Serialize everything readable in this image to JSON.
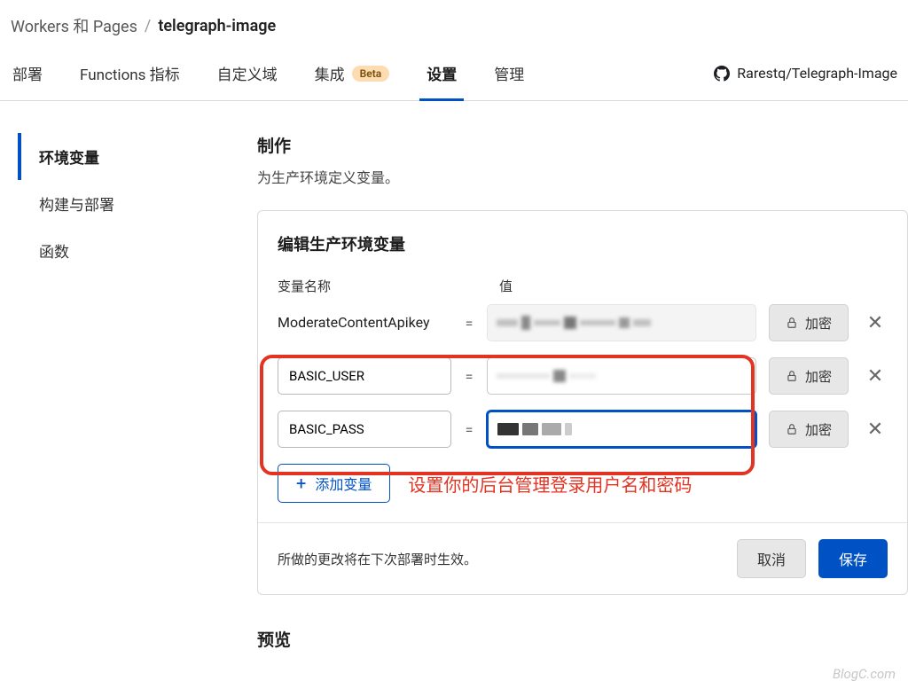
{
  "breadcrumb": {
    "parent": "Workers 和 Pages",
    "current": "telegraph-image"
  },
  "tabs": {
    "items": [
      {
        "label": "部署"
      },
      {
        "label": "Functions 指标"
      },
      {
        "label": "自定义域"
      },
      {
        "label": "集成",
        "badge": "Beta"
      },
      {
        "label": "设置",
        "active": true
      },
      {
        "label": "管理"
      }
    ],
    "repo": "Rarestq/Telegraph-Image"
  },
  "sidebar": {
    "items": [
      {
        "label": "环境变量",
        "active": true
      },
      {
        "label": "构建与部署"
      },
      {
        "label": "函数"
      }
    ]
  },
  "production": {
    "title": "制作",
    "desc": "为生产环境定义变量。"
  },
  "card": {
    "title": "编辑生产环境变量",
    "name_header": "变量名称",
    "value_header": "值",
    "vars": [
      {
        "name": "ModerateContentApikey",
        "value": ""
      },
      {
        "name": "BASIC_USER",
        "value": ""
      },
      {
        "name": "BASIC_PASS",
        "value": ""
      }
    ],
    "encrypt_label": "加密",
    "add_label": "添加变量",
    "annotation": "设置你的后台管理登录用户名和密码",
    "footer_note": "所做的更改将在下次部署时生效。",
    "cancel_label": "取消",
    "save_label": "保存"
  },
  "preview": {
    "title": "预览"
  },
  "watermark": "BlogC.com"
}
